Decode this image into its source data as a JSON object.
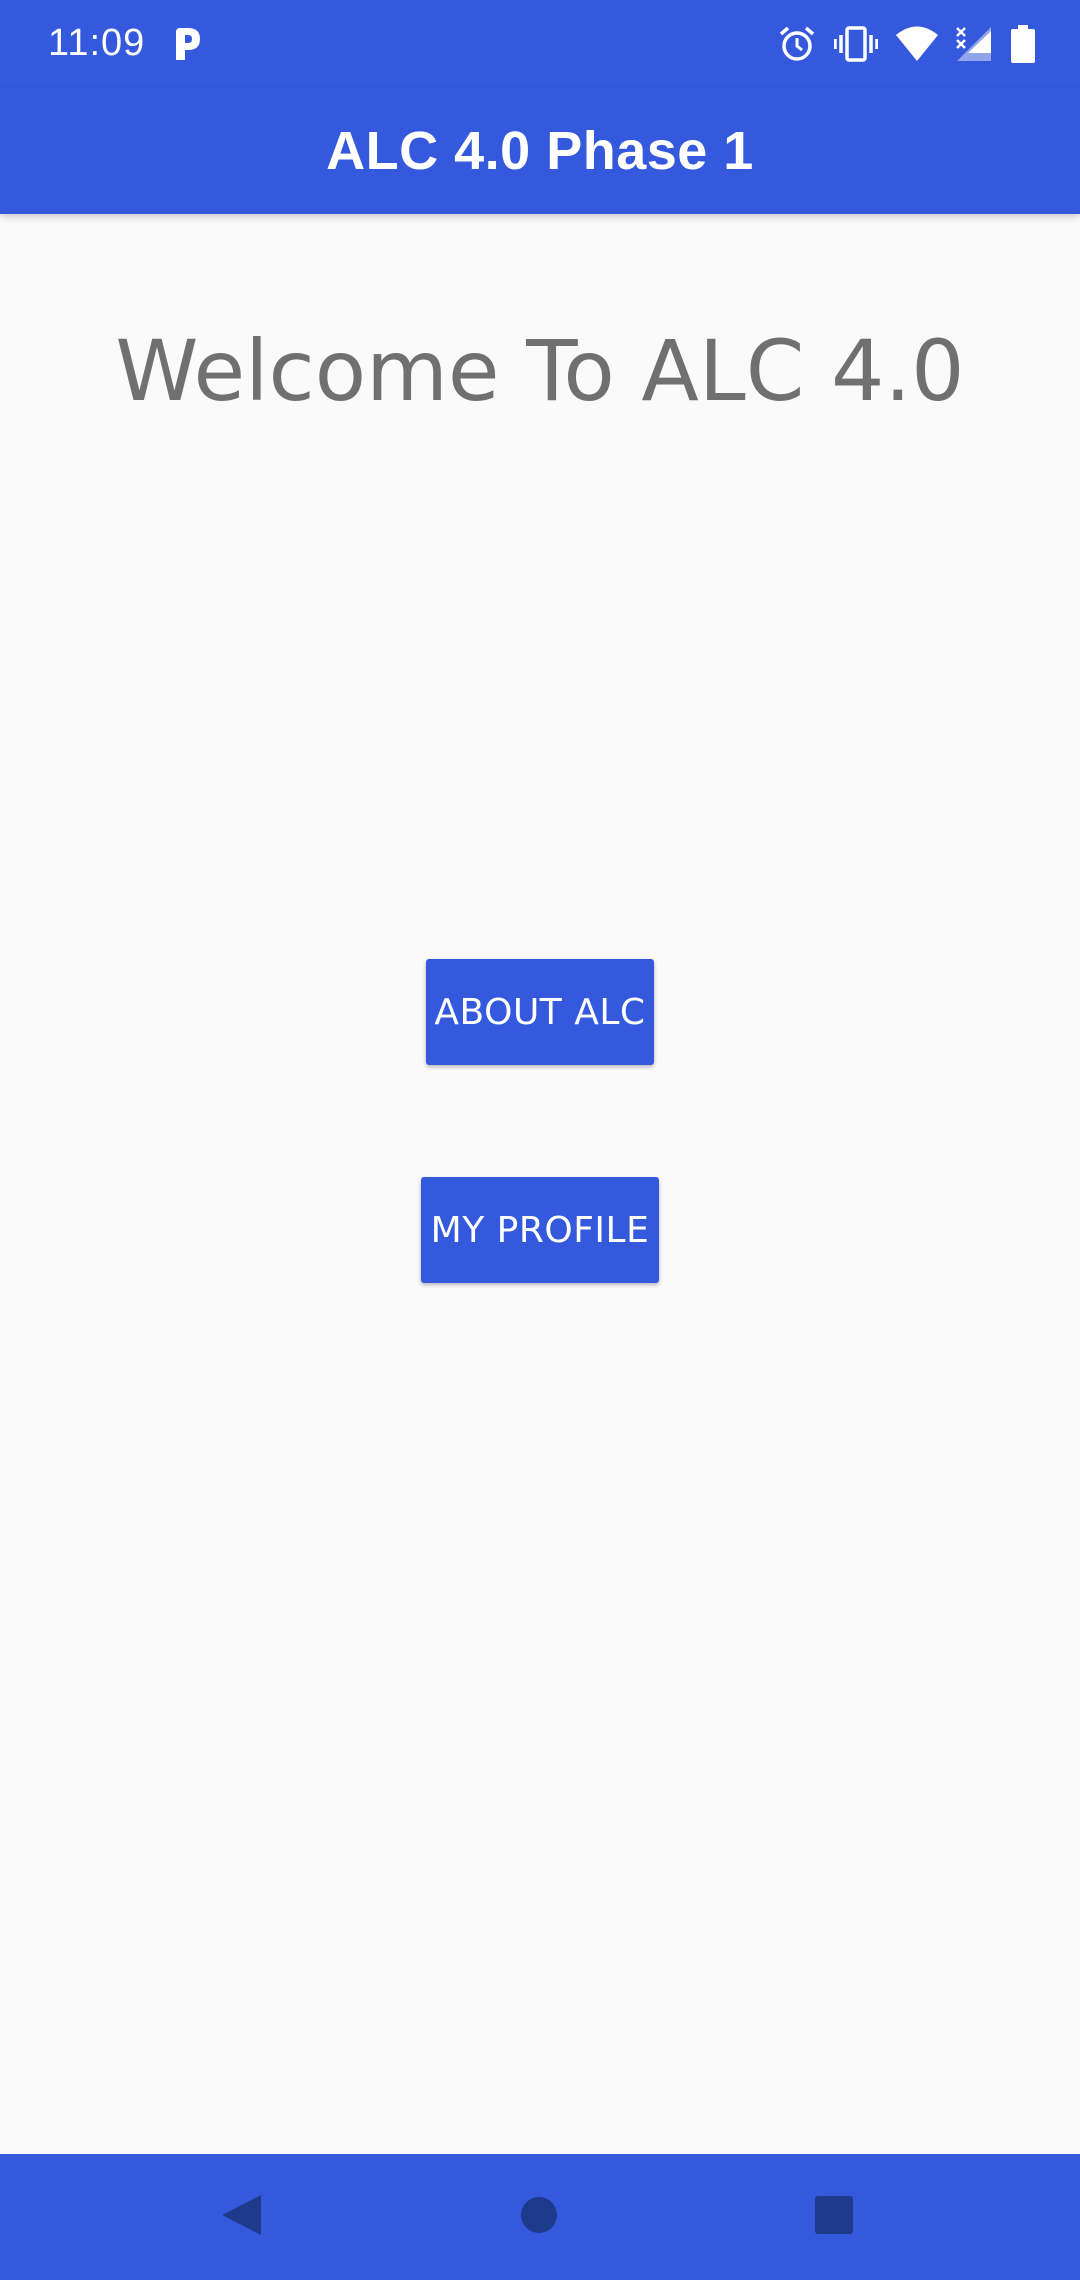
{
  "status_bar": {
    "time": "11:09",
    "icons": [
      "parking-icon",
      "alarm-icon",
      "vibrate-icon",
      "wifi-icon",
      "cellular-no-signal-icon",
      "battery-icon"
    ]
  },
  "toolbar": {
    "title": "ALC 4.0 Phase 1"
  },
  "main": {
    "welcome_text": "Welcome To ALC 4.0",
    "buttons": {
      "about": "ABOUT ALC",
      "profile": "MY PROFILE"
    }
  },
  "nav_bar": {
    "buttons": [
      "back-icon",
      "home-icon",
      "recents-icon"
    ]
  },
  "colors": {
    "primary": "#3559dd",
    "background": "#fafafa",
    "welcome_text": "#707070",
    "nav_icon": "#1e3a8a"
  }
}
